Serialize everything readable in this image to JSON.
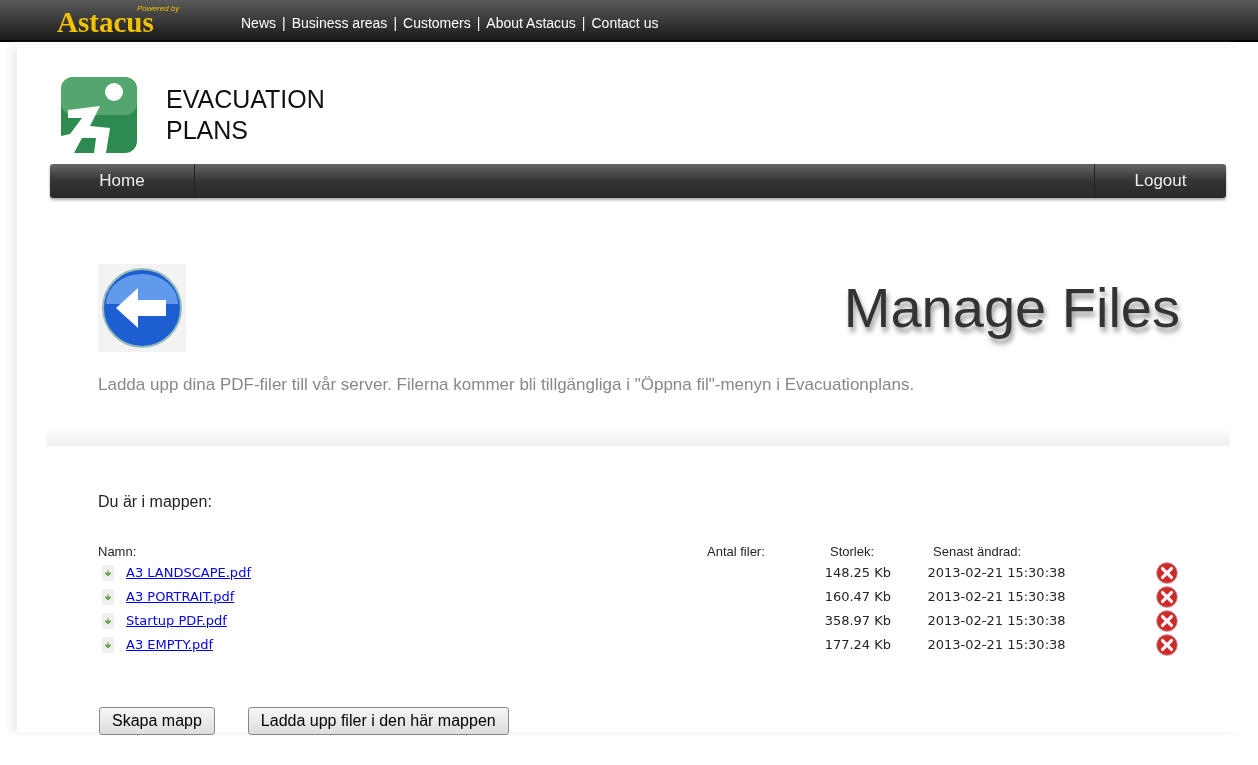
{
  "top_bar": {
    "brand": "Astacus",
    "powered_by": "Powered by",
    "separator": "|",
    "links": [
      "News",
      "Business areas",
      "Customers",
      "About Astacus",
      "Contact us"
    ]
  },
  "app_header": {
    "title": "EVACUATION PLANS"
  },
  "menu": {
    "left": "Home",
    "right": "Logout"
  },
  "page": {
    "title": "Manage Files",
    "description": "Ladda upp dina PDF-filer till vår server. Filerna kommer bli tillgängliga i \"Öppna fil\"-menyn i Evacuationplans."
  },
  "folder_label": "Du är i mappen:",
  "table": {
    "columns": [
      "Namn:",
      "Antal filer:",
      "Storlek:",
      "Senast ändrad:"
    ],
    "rows": [
      {
        "name": "A3 LANDSCAPE.pdf",
        "size": "148.25 Kb",
        "modified": "2013-02-21 15:30:38"
      },
      {
        "name": "A3 PORTRAIT.pdf",
        "size": "160.47 Kb",
        "modified": "2013-02-21 15:30:38"
      },
      {
        "name": "Startup PDF.pdf",
        "size": "358.97 Kb",
        "modified": "2013-02-21 15:30:38"
      },
      {
        "name": "A3 EMPTY.pdf",
        "size": "177.24 Kb",
        "modified": "2013-02-21 15:30:38"
      }
    ]
  },
  "buttons": [
    "Skapa mapp",
    "Ladda upp filer i den här mappen"
  ]
}
